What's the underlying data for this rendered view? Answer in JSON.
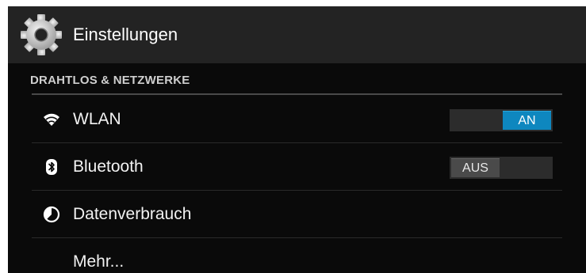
{
  "app": {
    "title": "Einstellungen",
    "icon": "gear-icon"
  },
  "section": {
    "title": "DRAHTLOS & NETZWERKE"
  },
  "rows": [
    {
      "label": "WLAN",
      "icon": "wifi-icon",
      "toggle": "AN",
      "state": "on"
    },
    {
      "label": "Bluetooth",
      "icon": "bluetooth-icon",
      "toggle": "AUS",
      "state": "off"
    },
    {
      "label": "Datenverbrauch",
      "icon": "data-usage-icon"
    },
    {
      "label": "Mehr..."
    }
  ],
  "colors": {
    "accent": "#0e87bf",
    "background": "#0a0a0a",
    "actionbar": "#232323"
  }
}
